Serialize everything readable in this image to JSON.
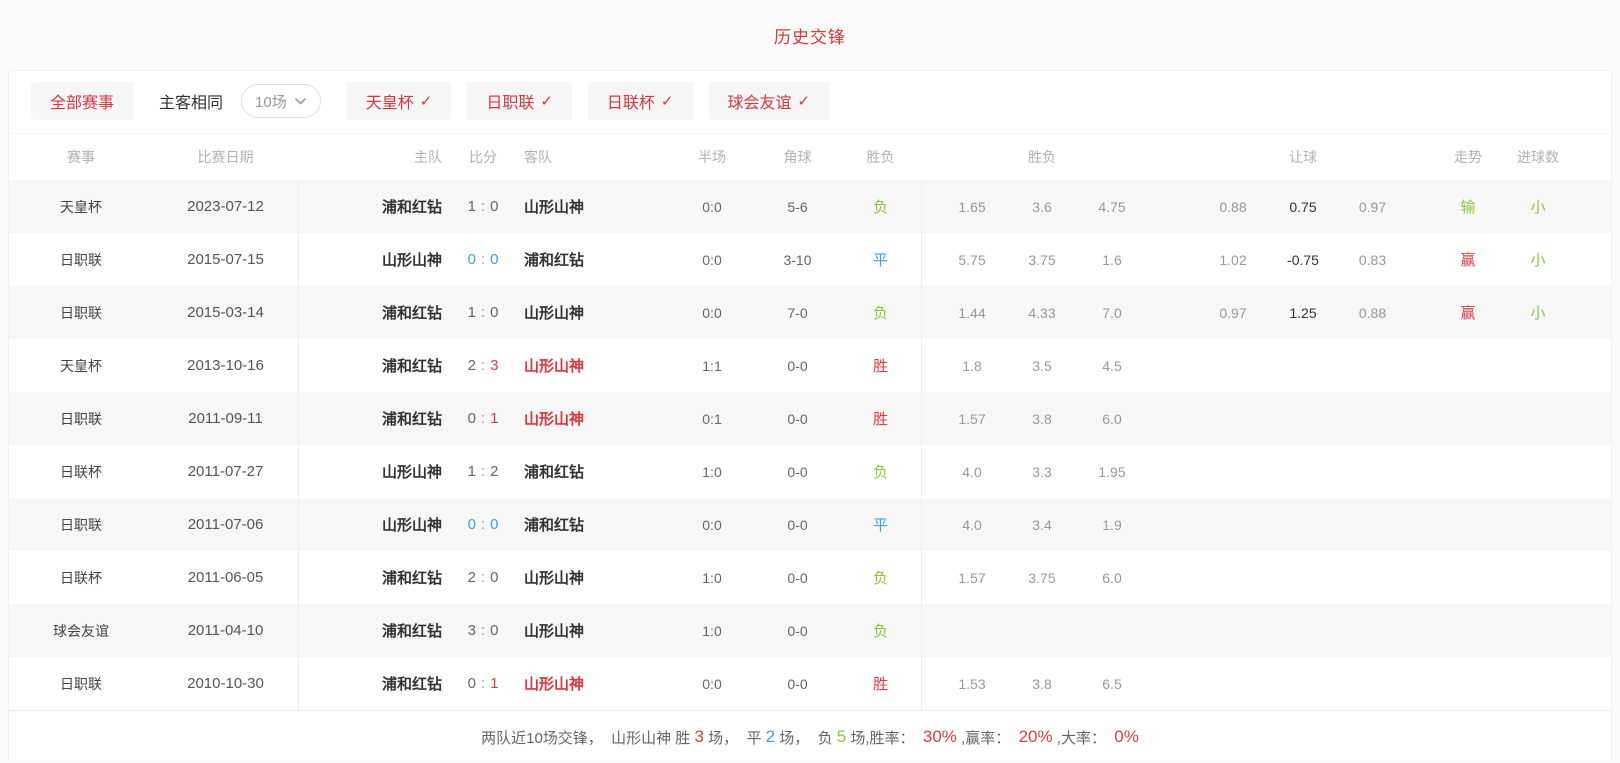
{
  "title": "历史交锋",
  "filters": {
    "all": "全部赛事",
    "same_side": "主客相同",
    "count": "10场",
    "check": "✓",
    "leagues": [
      "天皇杯",
      "日职联",
      "日联杯",
      "球会友谊"
    ]
  },
  "columns": {
    "league": "赛事",
    "date": "比赛日期",
    "home": "主队",
    "score": "比分",
    "away": "客队",
    "half": "半场",
    "corner": "角球",
    "result": "胜负",
    "odds": "胜负",
    "handicap": "让球",
    "trend": "走势",
    "goals": "进球数"
  },
  "colors": {
    "brand_red": "#d9363e",
    "win_red": "#e03b40",
    "lose_green": "#8ec53e",
    "draw_blue": "#3d9fe8"
  },
  "table": {
    "rows": [
      {
        "league": "天皇杯",
        "date": "2023-07-12",
        "home": "浦和红钻",
        "home_color": "dark",
        "sh": "1",
        "shc": "gray",
        "sa": "0",
        "sac": "gray",
        "away": "山形山神",
        "away_color": "dark",
        "half": "0:0",
        "corner": "5-6",
        "result": "负",
        "result_color": "green",
        "o1": "1.65",
        "o2": "3.6",
        "o3": "4.75",
        "h1": "0.88",
        "h2": "0.75",
        "h3": "0.97",
        "trend": "输",
        "trend_color": "green",
        "goals": "小",
        "goals_color": "green"
      },
      {
        "league": "日职联",
        "date": "2015-07-15",
        "home": "山形山神",
        "home_color": "dark",
        "sh": "0",
        "shc": "blue",
        "sa": "0",
        "sac": "blue",
        "away": "浦和红钻",
        "away_color": "dark",
        "half": "0:0",
        "corner": "3-10",
        "result": "平",
        "result_color": "blue",
        "o1": "5.75",
        "o2": "3.75",
        "o3": "1.6",
        "h1": "1.02",
        "h2": "-0.75",
        "h3": "0.83",
        "trend": "赢",
        "trend_color": "red",
        "goals": "小",
        "goals_color": "green"
      },
      {
        "league": "日职联",
        "date": "2015-03-14",
        "home": "浦和红钻",
        "home_color": "dark",
        "sh": "1",
        "shc": "gray",
        "sa": "0",
        "sac": "gray",
        "away": "山形山神",
        "away_color": "dark",
        "half": "0:0",
        "corner": "7-0",
        "result": "负",
        "result_color": "green",
        "o1": "1.44",
        "o2": "4.33",
        "o3": "7.0",
        "h1": "0.97",
        "h2": "1.25",
        "h3": "0.88",
        "trend": "赢",
        "trend_color": "red",
        "goals": "小",
        "goals_color": "green"
      },
      {
        "league": "天皇杯",
        "date": "2013-10-16",
        "home": "浦和红钻",
        "home_color": "dark",
        "sh": "2",
        "shc": "gray",
        "sa": "3",
        "sac": "red",
        "away": "山形山神",
        "away_color": "teamred",
        "half": "1:1",
        "corner": "0-0",
        "result": "胜",
        "result_color": "red",
        "o1": "1.8",
        "o2": "3.5",
        "o3": "4.5",
        "h1": "",
        "h2": "",
        "h3": "",
        "trend": "",
        "trend_color": "",
        "goals": "",
        "goals_color": ""
      },
      {
        "league": "日职联",
        "date": "2011-09-11",
        "home": "浦和红钻",
        "home_color": "dark",
        "sh": "0",
        "shc": "gray",
        "sa": "1",
        "sac": "red",
        "away": "山形山神",
        "away_color": "teamred",
        "half": "0:1",
        "corner": "0-0",
        "result": "胜",
        "result_color": "red",
        "o1": "1.57",
        "o2": "3.8",
        "o3": "6.0",
        "h1": "",
        "h2": "",
        "h3": "",
        "trend": "",
        "trend_color": "",
        "goals": "",
        "goals_color": ""
      },
      {
        "league": "日联杯",
        "date": "2011-07-27",
        "home": "山形山神",
        "home_color": "dark",
        "sh": "1",
        "shc": "gray",
        "sa": "2",
        "sac": "gray",
        "away": "浦和红钻",
        "away_color": "dark",
        "half": "1:0",
        "corner": "0-0",
        "result": "负",
        "result_color": "green",
        "o1": "4.0",
        "o2": "3.3",
        "o3": "1.95",
        "h1": "",
        "h2": "",
        "h3": "",
        "trend": "",
        "trend_color": "",
        "goals": "",
        "goals_color": ""
      },
      {
        "league": "日职联",
        "date": "2011-07-06",
        "home": "山形山神",
        "home_color": "dark",
        "sh": "0",
        "shc": "blue",
        "sa": "0",
        "sac": "blue",
        "away": "浦和红钻",
        "away_color": "dark",
        "half": "0:0",
        "corner": "0-0",
        "result": "平",
        "result_color": "blue",
        "o1": "4.0",
        "o2": "3.4",
        "o3": "1.9",
        "h1": "",
        "h2": "",
        "h3": "",
        "trend": "",
        "trend_color": "",
        "goals": "",
        "goals_color": ""
      },
      {
        "league": "日联杯",
        "date": "2011-06-05",
        "home": "浦和红钻",
        "home_color": "dark",
        "sh": "2",
        "shc": "gray",
        "sa": "0",
        "sac": "gray",
        "away": "山形山神",
        "away_color": "dark",
        "half": "1:0",
        "corner": "0-0",
        "result": "负",
        "result_color": "green",
        "o1": "1.57",
        "o2": "3.75",
        "o3": "6.0",
        "h1": "",
        "h2": "",
        "h3": "",
        "trend": "",
        "trend_color": "",
        "goals": "",
        "goals_color": ""
      },
      {
        "league": "球会友谊",
        "date": "2011-04-10",
        "home": "浦和红钻",
        "home_color": "dark",
        "sh": "3",
        "shc": "gray",
        "sa": "0",
        "sac": "gray",
        "away": "山形山神",
        "away_color": "dark",
        "half": "1:0",
        "corner": "0-0",
        "result": "负",
        "result_color": "green",
        "o1": "",
        "o2": "",
        "o3": "",
        "h1": "",
        "h2": "",
        "h3": "",
        "trend": "",
        "trend_color": "",
        "goals": "",
        "goals_color": ""
      },
      {
        "league": "日职联",
        "date": "2010-10-30",
        "home": "浦和红钻",
        "home_color": "dark",
        "sh": "0",
        "shc": "gray",
        "sa": "1",
        "sac": "red",
        "away": "山形山神",
        "away_color": "teamred",
        "half": "0:0",
        "corner": "0-0",
        "result": "胜",
        "result_color": "red",
        "o1": "1.53",
        "o2": "3.8",
        "o3": "6.5",
        "h1": "",
        "h2": "",
        "h3": "",
        "trend": "",
        "trend_color": "",
        "goals": "",
        "goals_color": ""
      }
    ]
  },
  "summary": {
    "s1": "两队近10场交锋，  山形山神 胜 ",
    "n1": "3",
    "s2": " 场，  平 ",
    "n2": "2",
    "s3": " 场，  负 ",
    "n3": "5",
    "s4": " 场,胜率：  ",
    "p1": "30%",
    "s5": " ,赢率：  ",
    "p2": "20%",
    "s6": " ,大率：  ",
    "p3": "0%"
  }
}
